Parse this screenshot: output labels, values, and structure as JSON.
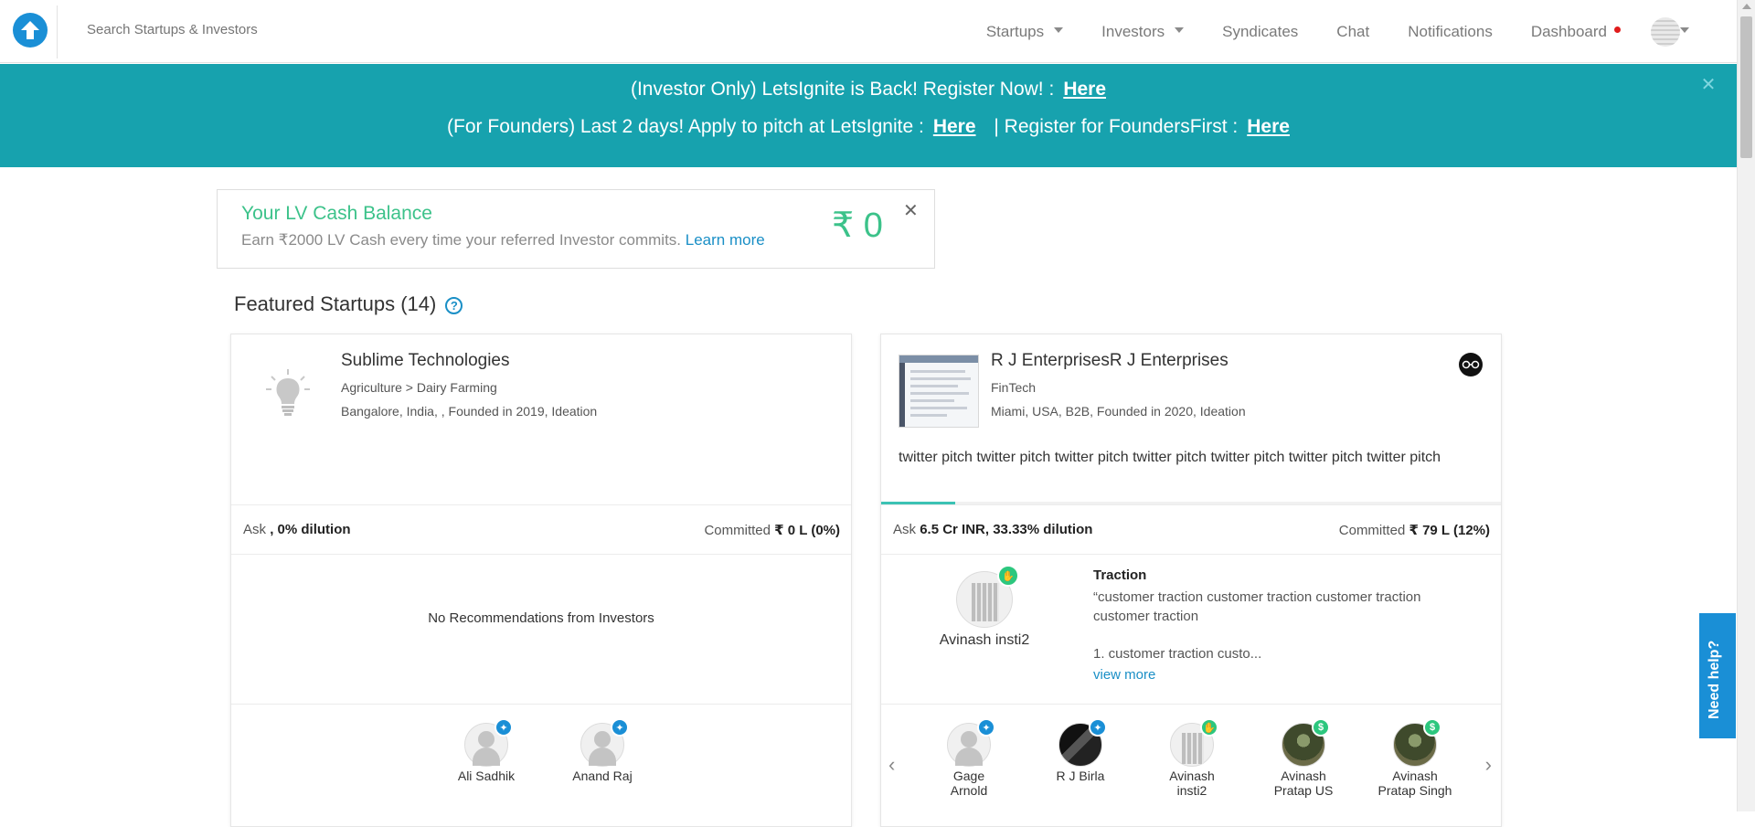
{
  "nav": {
    "search_placeholder": "Search Startups & Investors",
    "items": [
      {
        "label": "Startups",
        "dropdown": true
      },
      {
        "label": "Investors",
        "dropdown": true
      },
      {
        "label": "Syndicates"
      },
      {
        "label": "Chat"
      },
      {
        "label": "Notifications"
      },
      {
        "label": "Dashboard"
      }
    ]
  },
  "banner": {
    "line1_text": "(Investor Only) LetsIgnite is Back! Register Now! :",
    "line1_link": "Here",
    "line2_text": "(For Founders) Last 2 days! Apply to pitch at LetsIgnite :",
    "line2_link": "Here",
    "line2_text2": "| Register for FoundersFirst :",
    "line2_link2": "Here",
    "close": "✕"
  },
  "cash": {
    "title": "Your LV Cash Balance",
    "subtitle": "Earn ₹2000 LV Cash every time your referred Investor commits.",
    "link": "Learn more",
    "amount": "₹ 0",
    "close": "✕"
  },
  "featured": {
    "heading": "Featured Startups (14)",
    "help": "?"
  },
  "cards": [
    {
      "name": "Sublime Technologies",
      "category": "Agriculture > Dairy Farming",
      "location": "Bangalore, India, , Founded in 2019, Ideation",
      "ask_label": "Ask",
      "ask_value": ", 0% dilution",
      "committed_label": "Committed",
      "committed_value": "₹ 0 L (0%)",
      "no_rec": "No Recommendations from Investors",
      "investors": [
        {
          "name": "Ali Sadhik"
        },
        {
          "name": "Anand Raj"
        }
      ]
    },
    {
      "name": "R J EnterprisesR J Enterprises",
      "category": "FinTech",
      "location": "Miami, USA, B2B, Founded in 2020, Ideation",
      "pitch": "twitter pitch twitter pitch twitter pitch twitter pitch twitter pitch twitter pitch twitter pitch",
      "progress": 0.12,
      "ask_label": "Ask",
      "ask_value": "6.5 Cr INR, 33.33% dilution",
      "committed_label": "Committed",
      "committed_value": "₹ 79 L (12%)",
      "recommender": "Avinash insti2",
      "traction_title": "Traction",
      "traction_text": "“customer traction customer traction customer traction customer traction",
      "traction_more": "1. customer traction custo...",
      "view_more": "view more",
      "investors": [
        {
          "name": "Gage Arnold"
        },
        {
          "name": "R J Birla"
        },
        {
          "name": "Avinash insti2"
        },
        {
          "name": "Avinash Pratap US"
        },
        {
          "name": "Avinash Pratap Singh"
        }
      ]
    }
  ],
  "help_tab": "Need help?"
}
